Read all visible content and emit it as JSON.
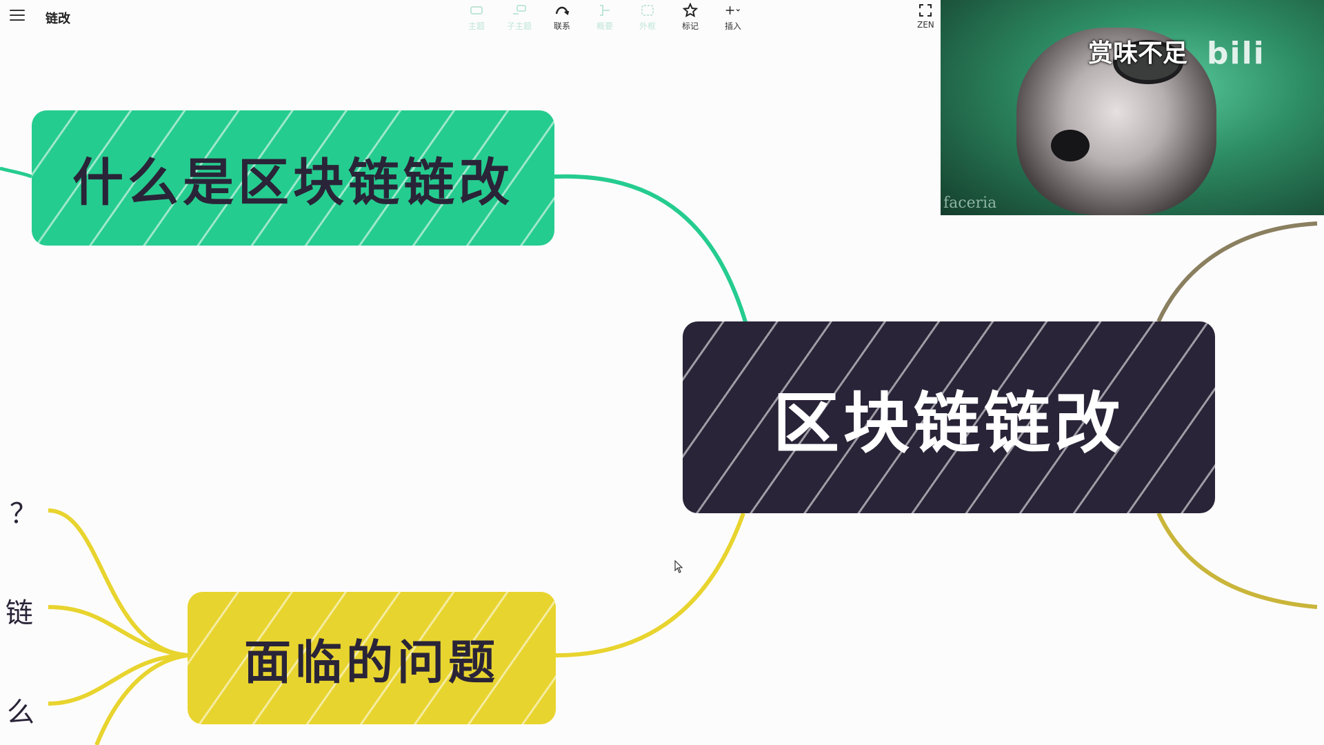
{
  "header": {
    "menu_icon": "hamburger-menu-icon",
    "title": "链改"
  },
  "toolbar": {
    "items": [
      {
        "label": "主题",
        "icon": "topic-icon",
        "enabled": false
      },
      {
        "label": "子主题",
        "icon": "subtopic-icon",
        "enabled": false
      },
      {
        "label": "联系",
        "icon": "relationship-icon",
        "enabled": true
      },
      {
        "label": "概要",
        "icon": "summary-icon",
        "enabled": false
      },
      {
        "label": "外框",
        "icon": "boundary-icon",
        "enabled": false
      },
      {
        "label": "标记",
        "icon": "star-icon",
        "enabled": true
      },
      {
        "label": "插入",
        "icon": "plus-icon",
        "enabled": true
      }
    ],
    "zen_label": "ZEN"
  },
  "webcam": {
    "caption": "赏味不足",
    "wordmark": "bili",
    "signature": "faceria"
  },
  "mindmap": {
    "root": "区块链链改",
    "topics": [
      {
        "label": "什么是区块链链改",
        "color": "#25cc8f"
      },
      {
        "label": "面临的问题",
        "color": "#e8d42e"
      }
    ],
    "leaves": [
      "？",
      "链",
      "么"
    ],
    "root_color": "#2a2438",
    "branch_right_color": "#8a7f5f"
  }
}
